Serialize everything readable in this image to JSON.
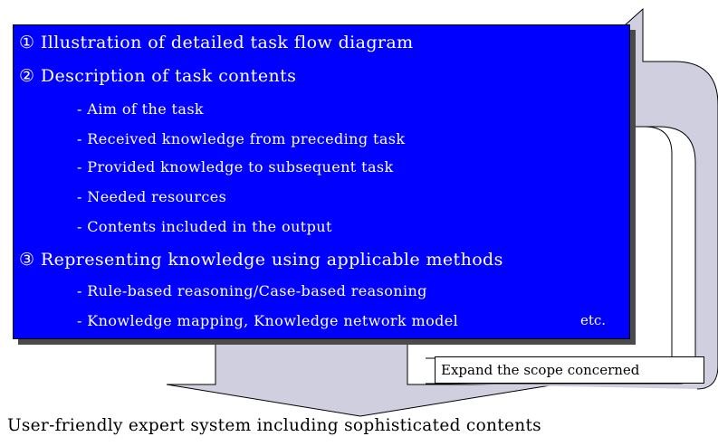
{
  "box": {
    "items": [
      {
        "text": "① Illustration of detailed task flow diagram",
        "level": 0
      },
      {
        "text": "② Description of task contents",
        "level": 0
      },
      {
        "text": "- Aim of the task",
        "level": 1
      },
      {
        "text": "- Received knowledge from preceding task",
        "level": 1
      },
      {
        "text": "- Provided knowledge to subsequent task",
        "level": 1
      },
      {
        "text": "- Needed resources",
        "level": 1
      },
      {
        "text": "- Contents included in the output",
        "level": 1
      },
      {
        "text": "③ Representing knowledge using applicable methods",
        "level": 0
      },
      {
        "text": "- Rule-based reasoning/Case-based reasoning",
        "level": 1
      },
      {
        "text": "- Knowledge mapping, Knowledge network model",
        "level": 1
      }
    ],
    "etc": "etc."
  },
  "expand_label": "Expand the scope concerned",
  "bottom_caption": "User-friendly expert system including sophisticated contents",
  "colors": {
    "box_fill": "#0000ff",
    "arrow_fill": "#cfcfe0",
    "text_on_box": "#ffffff"
  }
}
